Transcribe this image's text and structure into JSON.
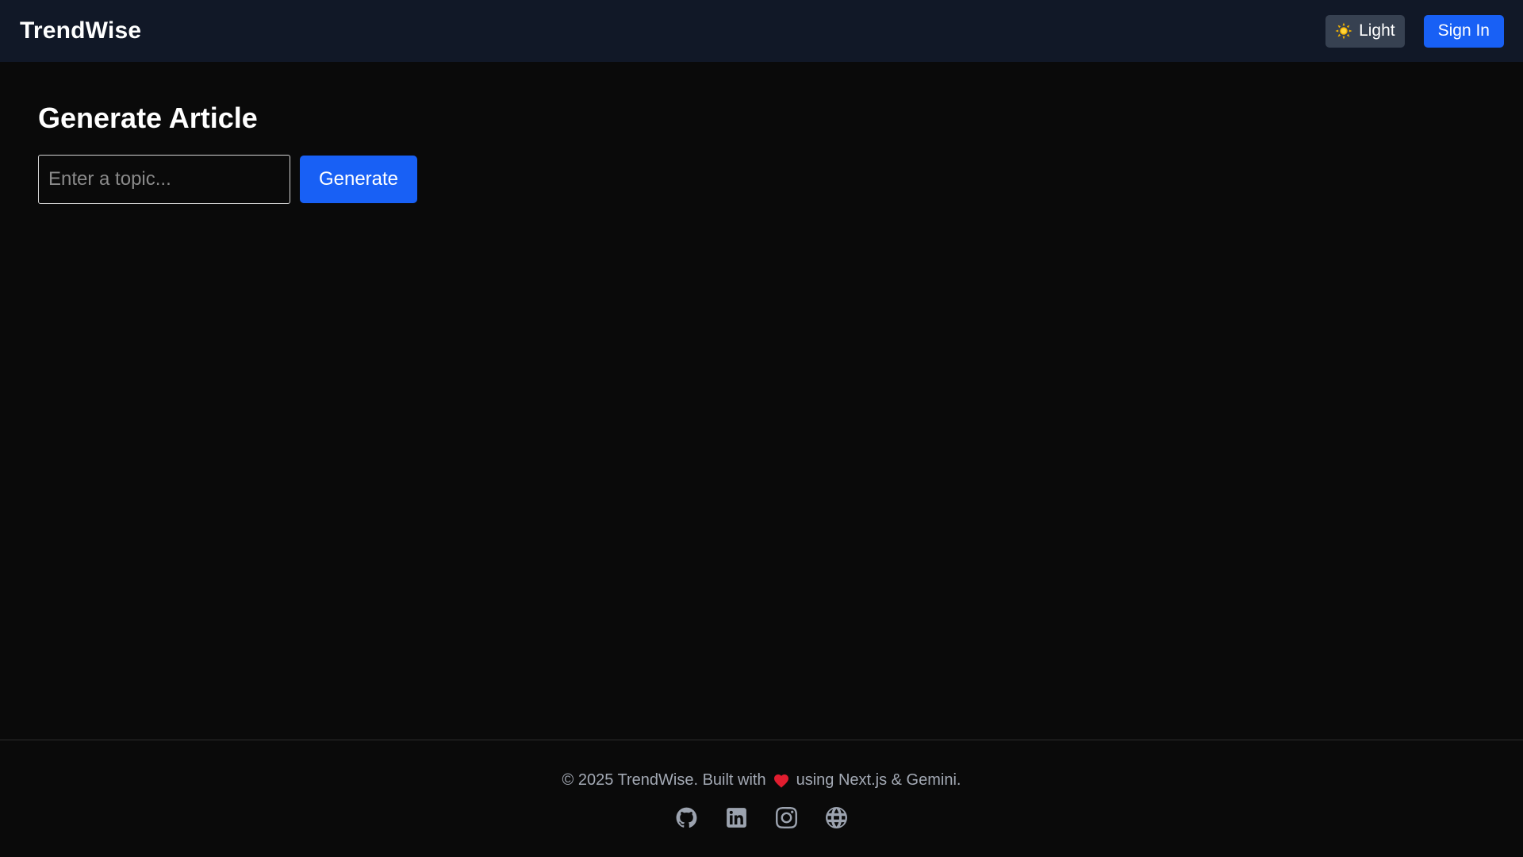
{
  "header": {
    "brand": "TrendWise",
    "theme_toggle": {
      "label": "Light",
      "icon": "sun-icon"
    },
    "signin_label": "Sign In"
  },
  "main": {
    "title": "Generate Article",
    "topic_input": {
      "value": "",
      "placeholder": "Enter a topic..."
    },
    "generate_label": "Generate"
  },
  "footer": {
    "text_before": "© 2025 TrendWise. Built with",
    "text_after": "using Next.js & Gemini.",
    "heart_icon": "heart-icon",
    "social_icons": [
      "github-icon",
      "linkedin-icon",
      "instagram-icon",
      "globe-icon"
    ]
  },
  "colors": {
    "background": "#0a0a0a",
    "navbar": "#111827",
    "accent": "#1860f5",
    "toggle_bg": "#374151",
    "footer_text": "#a3a9b4",
    "heart": "#e11d2f"
  }
}
